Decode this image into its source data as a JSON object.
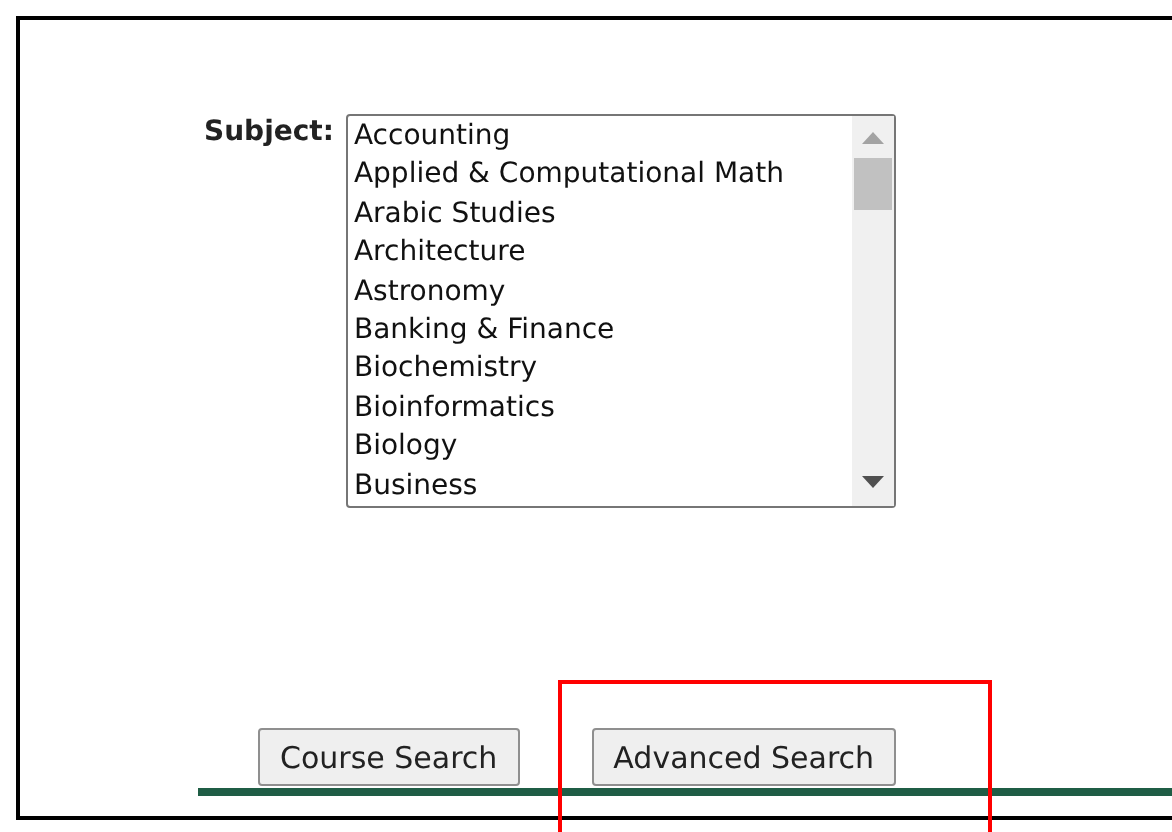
{
  "subject": {
    "label": "Subject:",
    "options": [
      {
        "label": "Accounting",
        "selected": false
      },
      {
        "label": "Applied & Computational Math",
        "selected": false
      },
      {
        "label": "Arabic Studies",
        "selected": false
      },
      {
        "label": "Architecture",
        "selected": false
      },
      {
        "label": "Astronomy",
        "selected": false
      },
      {
        "label": "Banking & Finance",
        "selected": false
      },
      {
        "label": "Biochemistry",
        "selected": false
      },
      {
        "label": "Bioinformatics",
        "selected": false
      },
      {
        "label": "Biology",
        "selected": false
      },
      {
        "label": "Business",
        "selected": false
      }
    ]
  },
  "buttons": [
    {
      "label": "Course Search",
      "highlighted": false
    },
    {
      "label": "Advanced Search",
      "highlighted": true
    }
  ]
}
